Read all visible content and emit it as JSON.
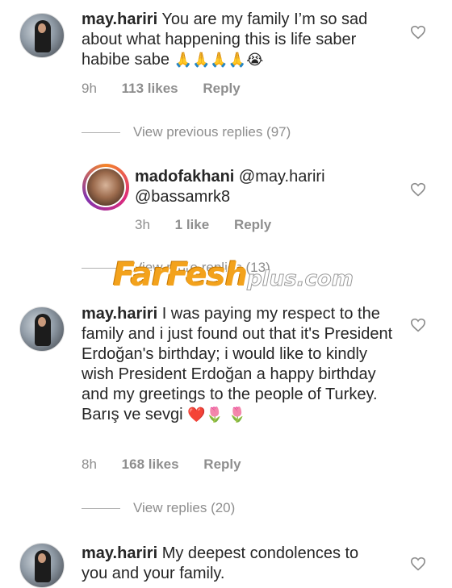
{
  "comments": [
    {
      "username": "may.hariri",
      "text": "You are my family I’m so sad about what happening  this is life saber habibe sabe",
      "emoji": "🙏🙏🙏🙏😭",
      "time": "9h",
      "likes": "113 likes",
      "reply": "Reply"
    },
    {
      "username": "madofakhani",
      "text": "@may.hariri @bassamrk8",
      "time": "3h",
      "likes": "1 like",
      "reply": "Reply"
    },
    {
      "username": "may.hariri",
      "text": "I was paying my respect to the family and i just found out that it's President Erdoğan's birthday; i would like to kindly wish President Erdoğan a happy birthday and my greetings to the people of Turkey. Barış ve sevgi",
      "emoji": "❤️🌷",
      "emoji2": "🌷",
      "time": "8h",
      "likes": "168 likes",
      "reply": "Reply"
    },
    {
      "username": "may.hariri",
      "text": "My deepest condolences to you and your family."
    }
  ],
  "thread": {
    "view_previous": "View previous replies (97)",
    "view_more": "View more replies (13)",
    "view_replies": "View replies (20)"
  },
  "watermark": {
    "main": "FarFesh",
    "plus": "plus.com"
  },
  "colors": {
    "meta": "#8e8e8e",
    "text": "#262626",
    "watermark": "#f3a21c"
  }
}
